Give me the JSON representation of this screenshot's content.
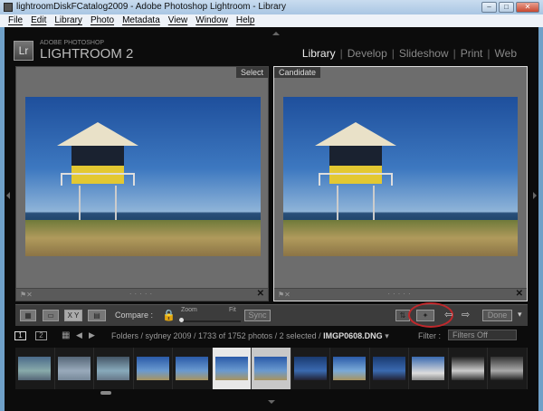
{
  "window": {
    "title": "lightroomDiskFCatalog2009 - Adobe Photoshop Lightroom - Library"
  },
  "menu": [
    "File",
    "Edit",
    "Library",
    "Photo",
    "Metadata",
    "View",
    "Window",
    "Help"
  ],
  "brand": {
    "logo": "Lr",
    "line1": "ADOBE PHOTOSHOP",
    "line2": "LIGHTROOM 2"
  },
  "modules": [
    "Library",
    "Develop",
    "Slideshow",
    "Print",
    "Web"
  ],
  "compare": {
    "select_label": "Select",
    "candidate_label": "Candidate"
  },
  "toolbar": {
    "compare_label": "Compare :",
    "zoom_label": "Zoom",
    "fit_label": "Fit",
    "sync_label": "Sync",
    "done_label": "Done",
    "xy_label": "X Y"
  },
  "filmstrip": {
    "page1": "1",
    "page2": "2",
    "breadcrumb": "Folders / sydney 2009 / 1733 of 1752 photos / 2 selected / ",
    "filename": "IMGP0608.DNG",
    "filter_label": "Filter :",
    "filter_value": "Filters Off"
  },
  "colors": {
    "accent_circle": "#c0282c"
  }
}
